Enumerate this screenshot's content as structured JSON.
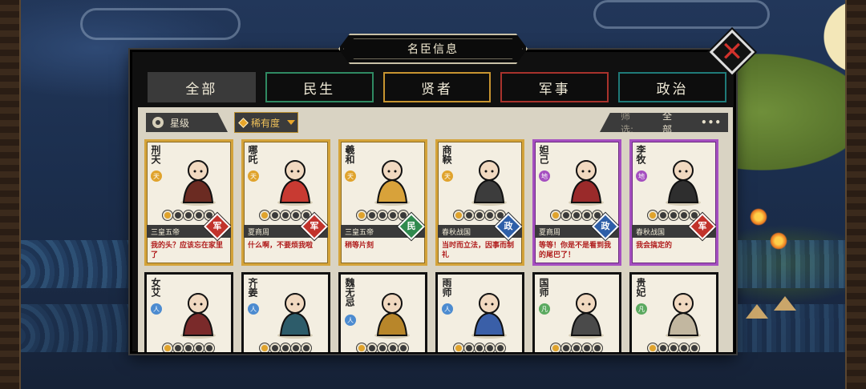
{
  "window": {
    "title": "名臣信息"
  },
  "tabs": [
    {
      "label": "全部",
      "active": true
    },
    {
      "label": "民生"
    },
    {
      "label": "贤者"
    },
    {
      "label": "军事"
    },
    {
      "label": "政治"
    }
  ],
  "filters": {
    "star_label": "星级",
    "rarity_label": "稀有度",
    "screen_label": "筛选:",
    "screen_value": "全部",
    "more": "•••"
  },
  "colors": {
    "tab_minsheng": "#2f8a62",
    "tab_xianzhe": "#c79430",
    "tab_junshi": "#a8322c",
    "tab_zhengzhi": "#1f7a78",
    "grade_tian": "#e0a32c",
    "grade_di": "#a54fc0",
    "grade_ren": "#4c8bd0",
    "grade_fan": "#5aa95f"
  },
  "cards": [
    {
      "name": "刑天",
      "grade": "天",
      "grade_key": "tian",
      "frame": "gold",
      "stars": 1,
      "dynasty": "三皇五帝",
      "type": "军",
      "type_key": "jun",
      "quote": "我的头？应该忘在家里了",
      "portrait": "headless-warrior-icon"
    },
    {
      "name": "哪吒",
      "grade": "天",
      "grade_key": "tian",
      "frame": "gold",
      "stars": 1,
      "dynasty": "夏商周",
      "type": "军",
      "type_key": "jun",
      "quote": "什么啊，不要烦我啦",
      "portrait": "child-deity-icon"
    },
    {
      "name": "羲和",
      "grade": "天",
      "grade_key": "tian",
      "frame": "gold",
      "stars": 1,
      "dynasty": "三皇五帝",
      "type": "民",
      "type_key": "min",
      "quote": "稍等片刻",
      "portrait": "sun-goddess-icon"
    },
    {
      "name": "商鞅",
      "grade": "天",
      "grade_key": "tian",
      "frame": "gold",
      "stars": 1,
      "dynasty": "春秋战国",
      "type": "政",
      "type_key": "zheng",
      "quote": "当时而立法，因事而制礼",
      "portrait": "scholar-icon"
    },
    {
      "name": "妲己",
      "grade": "地",
      "grade_key": "di",
      "frame": "purple",
      "stars": 1,
      "dynasty": "夏商周",
      "type": "政",
      "type_key": "zheng",
      "quote": "等等！你是不是看到我的尾巴了！",
      "portrait": "fox-lady-icon"
    },
    {
      "name": "李牧",
      "grade": "地",
      "grade_key": "di",
      "frame": "purple",
      "stars": 1,
      "dynasty": "春秋战国",
      "type": "军",
      "type_key": "jun",
      "quote": "我会搞定的",
      "portrait": "general-icon"
    },
    {
      "name": "女艾",
      "grade": "人",
      "grade_key": "ren",
      "frame": "plain",
      "stars": 1,
      "portrait": "straw-hat-woman-icon"
    },
    {
      "name": "齐姜",
      "grade": "人",
      "grade_key": "ren",
      "frame": "plain",
      "stars": 1,
      "portrait": "noble-lady-icon"
    },
    {
      "name": "魏无忌",
      "grade": "人",
      "grade_key": "ren",
      "frame": "plain",
      "stars": 1,
      "portrait": "lord-icon"
    },
    {
      "name": "雨师",
      "grade": "人",
      "grade_key": "ren",
      "frame": "plain",
      "stars": 1,
      "portrait": "rain-master-icon"
    },
    {
      "name": "国师",
      "grade": "凡",
      "grade_key": "fan",
      "frame": "plain",
      "stars": 1,
      "portrait": "priest-icon"
    },
    {
      "name": "贵妃",
      "grade": "凡",
      "grade_key": "fan",
      "frame": "plain",
      "stars": 1,
      "portrait": "consort-icon"
    }
  ]
}
